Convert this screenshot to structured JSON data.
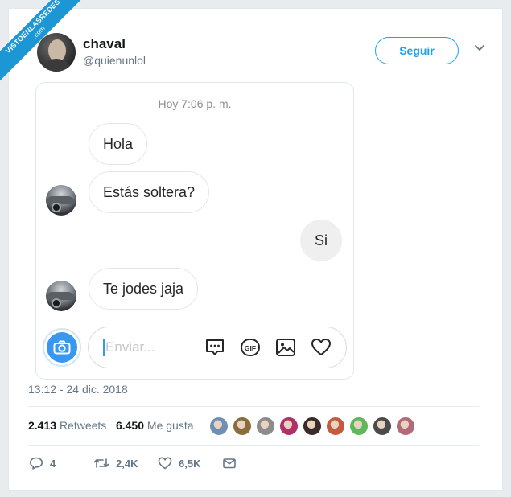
{
  "watermark": {
    "line1": "VISTOENLASREDES",
    "line2": ".com"
  },
  "tweet": {
    "display_name": "chaval",
    "handle": "@quienunlol",
    "follow_label": "Seguir",
    "timestamp": "13:12 - 24 dic. 2018",
    "retweets_count": "2.413",
    "retweets_label": "Retweets",
    "likes_count": "6.450",
    "likes_label": "Me gusta",
    "replies": "4",
    "retweets_short": "2,4K",
    "likes_short": "6,5K"
  },
  "chat": {
    "time_header": "Hoy 7:06 p. m.",
    "messages": [
      {
        "text": "Hola",
        "from": "them"
      },
      {
        "text": "Estás soltera?",
        "from": "them"
      },
      {
        "text": "Si",
        "from": "me"
      },
      {
        "text": "Te jodes jaja",
        "from": "them"
      }
    ],
    "input_placeholder": "Enviar...",
    "composer_icons": [
      "chat-bubble-icon",
      "gif-icon",
      "image-icon",
      "heart-icon"
    ]
  },
  "colors": {
    "accent": "#1da1f2",
    "camera": "#3897f0",
    "ribbon": "#1c97d4",
    "muted_text": "#657786"
  },
  "liker_colors": [
    "#6f8fb3",
    "#8a6d3b",
    "#8c8c8c",
    "#b0306a",
    "#3a2a2a",
    "#c25b3f",
    "#5fb85a",
    "#4b4b4b",
    "#b26a7a"
  ]
}
